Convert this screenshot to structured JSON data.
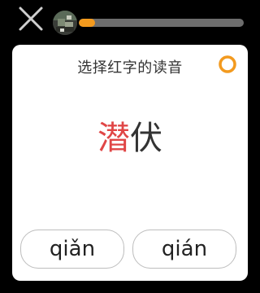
{
  "header": {
    "close_icon": "close-icon",
    "avatar_icon": "avatar-image",
    "progress": {
      "fraction": 0.1,
      "fill_color": "#f39a1e",
      "track_color": "#6d6d6d"
    }
  },
  "question": {
    "prompt": "选择红字的读音",
    "timer_icon": "timer-ring-icon",
    "word_highlight": "潜",
    "word_rest": "伏",
    "highlight_color": "#e04646"
  },
  "options": [
    {
      "label": "qiǎn"
    },
    {
      "label": "qián"
    }
  ]
}
